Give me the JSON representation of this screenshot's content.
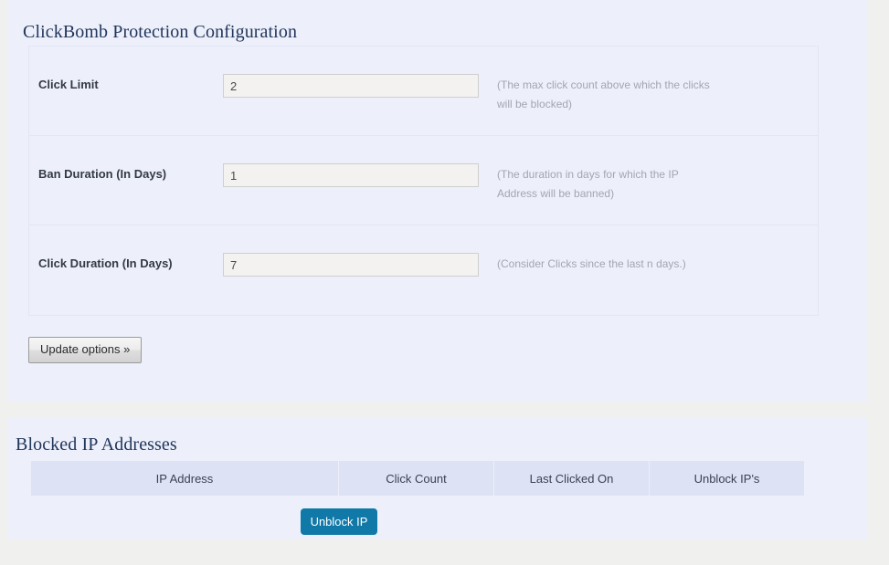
{
  "config_section": {
    "title": "ClickBomb Protection Configuration",
    "rows": [
      {
        "label": "Click Limit",
        "value": "2",
        "help": "(The max click count above which the clicks will be blocked)"
      },
      {
        "label": "Ban Duration (In Days)",
        "value": "1",
        "help": "(The duration in days for which the IP Address will be banned)"
      },
      {
        "label": "Click Duration (In Days)",
        "value": "7",
        "help": "(Consider Clicks since the last n days.)"
      }
    ],
    "update_button": "Update options »"
  },
  "blocked_section": {
    "title": "Blocked IP Addresses",
    "columns": [
      "IP Address",
      "Click Count",
      "Last Clicked On",
      "Unblock IP's"
    ],
    "rows": [],
    "unblock_button": "Unblock IP"
  },
  "colors": {
    "panel_background": "#edf0fb",
    "page_background": "#f0f0ee",
    "title_text": "#21355b",
    "help_text": "#a3a6af",
    "table_header_background": "#dde2f4",
    "unblock_button_background": "#1179a8"
  }
}
